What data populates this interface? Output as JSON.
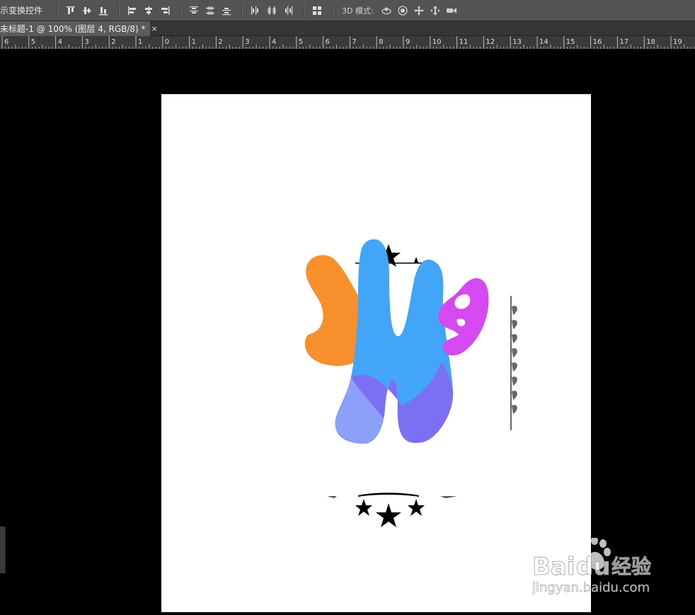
{
  "options_bar": {
    "label": "示变换控件",
    "mode3d_label": "3D 模式:"
  },
  "document_tab": {
    "title": "未标题-1 @ 100% (图层 4, RGB/8) *",
    "close": "×"
  },
  "ruler": {
    "labels": [
      "6",
      "5",
      "4",
      "3",
      "2",
      "1",
      "0",
      "1",
      "2",
      "3",
      "4",
      "5",
      "6",
      "7",
      "8",
      "9",
      "10",
      "11",
      "12",
      "13",
      "14",
      "15",
      "16",
      "17",
      "18",
      "19"
    ]
  },
  "watermark": {
    "brand": "Bai",
    "brand2": "du",
    "cn": "经验",
    "url": "jingyan.baidu.com"
  },
  "colors": {
    "orange": "#F7902C",
    "blue": "#42A5F8",
    "purple": "#7B6FF2",
    "magenta": "#D54AF0",
    "ui_bg": "#535353"
  }
}
